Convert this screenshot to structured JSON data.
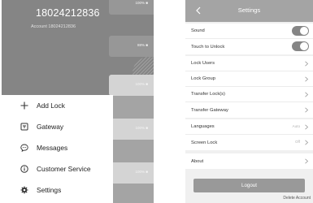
{
  "left_screen": {
    "phone_number": "18024212836",
    "account_line": "Account 18024212836",
    "background_cards": [
      {
        "battery": "100% ■"
      },
      {
        "battery": "88% ■"
      },
      {
        "battery": "100% ■"
      },
      {
        "battery": "100% ■"
      },
      {
        "battery": "100% ■"
      }
    ],
    "menu": [
      {
        "label": "Add Lock",
        "icon": "plus-icon"
      },
      {
        "label": "Gateway",
        "icon": "gateway-icon"
      },
      {
        "label": "Messages",
        "icon": "message-icon"
      },
      {
        "label": "Customer Service",
        "icon": "info-icon"
      },
      {
        "label": "Settings",
        "icon": "gear-icon"
      }
    ]
  },
  "right_screen": {
    "title": "Settings",
    "back_icon": "chevron-left-icon",
    "toggle_rows": [
      {
        "label": "Sound",
        "on": true
      },
      {
        "label": "Touch to Unlock",
        "on": true
      }
    ],
    "nav_rows": [
      {
        "label": "Lock Users"
      },
      {
        "label": "Lock Group"
      },
      {
        "label": "Transfer Lock(s)"
      },
      {
        "label": "Transfer Gateway"
      }
    ],
    "pref_rows": [
      {
        "label": "Languages",
        "value": "Auto"
      },
      {
        "label": "Screen Lock",
        "value": "Off"
      }
    ],
    "about_row": {
      "label": "About"
    },
    "logout_label": "Logout",
    "delete_account_label": "Delete Account"
  },
  "colors": {
    "overlay_gray": "#a4a4a4",
    "header_gray": "#858585",
    "toggle_on": "#858585",
    "logout_bg": "#999999"
  }
}
